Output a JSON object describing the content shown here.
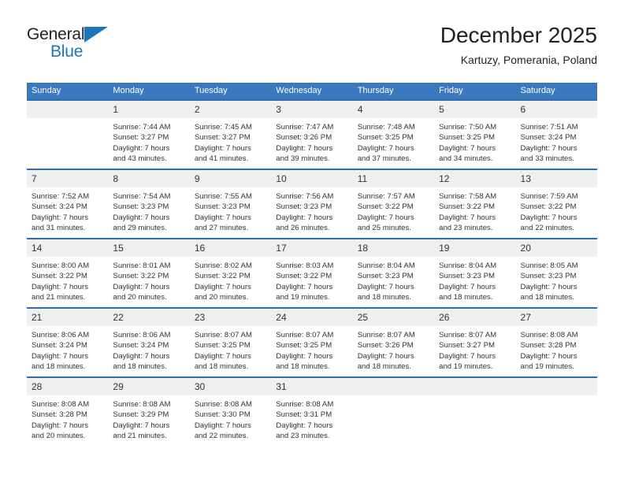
{
  "brand": {
    "line1": "General",
    "line2": "Blue",
    "triangle_color": "#1b75bb",
    "text_color": "#231f20"
  },
  "header": {
    "title": "December 2025",
    "subtitle": "Kartuzy, Pomerania, Poland"
  },
  "theme": {
    "header_blue": "#3a79bd",
    "row_border_blue": "#2f6fb0",
    "daynum_band": "#efefef",
    "body_text": "#333333"
  },
  "weekdays": [
    "Sunday",
    "Monday",
    "Tuesday",
    "Wednesday",
    "Thursday",
    "Friday",
    "Saturday"
  ],
  "weeks": [
    [
      {
        "day": "",
        "lines": []
      },
      {
        "day": "1",
        "lines": [
          "Sunrise: 7:44 AM",
          "Sunset: 3:27 PM",
          "Daylight: 7 hours",
          "and 43 minutes."
        ]
      },
      {
        "day": "2",
        "lines": [
          "Sunrise: 7:45 AM",
          "Sunset: 3:27 PM",
          "Daylight: 7 hours",
          "and 41 minutes."
        ]
      },
      {
        "day": "3",
        "lines": [
          "Sunrise: 7:47 AM",
          "Sunset: 3:26 PM",
          "Daylight: 7 hours",
          "and 39 minutes."
        ]
      },
      {
        "day": "4",
        "lines": [
          "Sunrise: 7:48 AM",
          "Sunset: 3:25 PM",
          "Daylight: 7 hours",
          "and 37 minutes."
        ]
      },
      {
        "day": "5",
        "lines": [
          "Sunrise: 7:50 AM",
          "Sunset: 3:25 PM",
          "Daylight: 7 hours",
          "and 34 minutes."
        ]
      },
      {
        "day": "6",
        "lines": [
          "Sunrise: 7:51 AM",
          "Sunset: 3:24 PM",
          "Daylight: 7 hours",
          "and 33 minutes."
        ]
      }
    ],
    [
      {
        "day": "7",
        "lines": [
          "Sunrise: 7:52 AM",
          "Sunset: 3:24 PM",
          "Daylight: 7 hours",
          "and 31 minutes."
        ]
      },
      {
        "day": "8",
        "lines": [
          "Sunrise: 7:54 AM",
          "Sunset: 3:23 PM",
          "Daylight: 7 hours",
          "and 29 minutes."
        ]
      },
      {
        "day": "9",
        "lines": [
          "Sunrise: 7:55 AM",
          "Sunset: 3:23 PM",
          "Daylight: 7 hours",
          "and 27 minutes."
        ]
      },
      {
        "day": "10",
        "lines": [
          "Sunrise: 7:56 AM",
          "Sunset: 3:23 PM",
          "Daylight: 7 hours",
          "and 26 minutes."
        ]
      },
      {
        "day": "11",
        "lines": [
          "Sunrise: 7:57 AM",
          "Sunset: 3:22 PM",
          "Daylight: 7 hours",
          "and 25 minutes."
        ]
      },
      {
        "day": "12",
        "lines": [
          "Sunrise: 7:58 AM",
          "Sunset: 3:22 PM",
          "Daylight: 7 hours",
          "and 23 minutes."
        ]
      },
      {
        "day": "13",
        "lines": [
          "Sunrise: 7:59 AM",
          "Sunset: 3:22 PM",
          "Daylight: 7 hours",
          "and 22 minutes."
        ]
      }
    ],
    [
      {
        "day": "14",
        "lines": [
          "Sunrise: 8:00 AM",
          "Sunset: 3:22 PM",
          "Daylight: 7 hours",
          "and 21 minutes."
        ]
      },
      {
        "day": "15",
        "lines": [
          "Sunrise: 8:01 AM",
          "Sunset: 3:22 PM",
          "Daylight: 7 hours",
          "and 20 minutes."
        ]
      },
      {
        "day": "16",
        "lines": [
          "Sunrise: 8:02 AM",
          "Sunset: 3:22 PM",
          "Daylight: 7 hours",
          "and 20 minutes."
        ]
      },
      {
        "day": "17",
        "lines": [
          "Sunrise: 8:03 AM",
          "Sunset: 3:22 PM",
          "Daylight: 7 hours",
          "and 19 minutes."
        ]
      },
      {
        "day": "18",
        "lines": [
          "Sunrise: 8:04 AM",
          "Sunset: 3:23 PM",
          "Daylight: 7 hours",
          "and 18 minutes."
        ]
      },
      {
        "day": "19",
        "lines": [
          "Sunrise: 8:04 AM",
          "Sunset: 3:23 PM",
          "Daylight: 7 hours",
          "and 18 minutes."
        ]
      },
      {
        "day": "20",
        "lines": [
          "Sunrise: 8:05 AM",
          "Sunset: 3:23 PM",
          "Daylight: 7 hours",
          "and 18 minutes."
        ]
      }
    ],
    [
      {
        "day": "21",
        "lines": [
          "Sunrise: 8:06 AM",
          "Sunset: 3:24 PM",
          "Daylight: 7 hours",
          "and 18 minutes."
        ]
      },
      {
        "day": "22",
        "lines": [
          "Sunrise: 8:06 AM",
          "Sunset: 3:24 PM",
          "Daylight: 7 hours",
          "and 18 minutes."
        ]
      },
      {
        "day": "23",
        "lines": [
          "Sunrise: 8:07 AM",
          "Sunset: 3:25 PM",
          "Daylight: 7 hours",
          "and 18 minutes."
        ]
      },
      {
        "day": "24",
        "lines": [
          "Sunrise: 8:07 AM",
          "Sunset: 3:25 PM",
          "Daylight: 7 hours",
          "and 18 minutes."
        ]
      },
      {
        "day": "25",
        "lines": [
          "Sunrise: 8:07 AM",
          "Sunset: 3:26 PM",
          "Daylight: 7 hours",
          "and 18 minutes."
        ]
      },
      {
        "day": "26",
        "lines": [
          "Sunrise: 8:07 AM",
          "Sunset: 3:27 PM",
          "Daylight: 7 hours",
          "and 19 minutes."
        ]
      },
      {
        "day": "27",
        "lines": [
          "Sunrise: 8:08 AM",
          "Sunset: 3:28 PM",
          "Daylight: 7 hours",
          "and 19 minutes."
        ]
      }
    ],
    [
      {
        "day": "28",
        "lines": [
          "Sunrise: 8:08 AM",
          "Sunset: 3:28 PM",
          "Daylight: 7 hours",
          "and 20 minutes."
        ]
      },
      {
        "day": "29",
        "lines": [
          "Sunrise: 8:08 AM",
          "Sunset: 3:29 PM",
          "Daylight: 7 hours",
          "and 21 minutes."
        ]
      },
      {
        "day": "30",
        "lines": [
          "Sunrise: 8:08 AM",
          "Sunset: 3:30 PM",
          "Daylight: 7 hours",
          "and 22 minutes."
        ]
      },
      {
        "day": "31",
        "lines": [
          "Sunrise: 8:08 AM",
          "Sunset: 3:31 PM",
          "Daylight: 7 hours",
          "and 23 minutes."
        ]
      },
      {
        "day": "",
        "lines": []
      },
      {
        "day": "",
        "lines": []
      },
      {
        "day": "",
        "lines": []
      }
    ]
  ]
}
